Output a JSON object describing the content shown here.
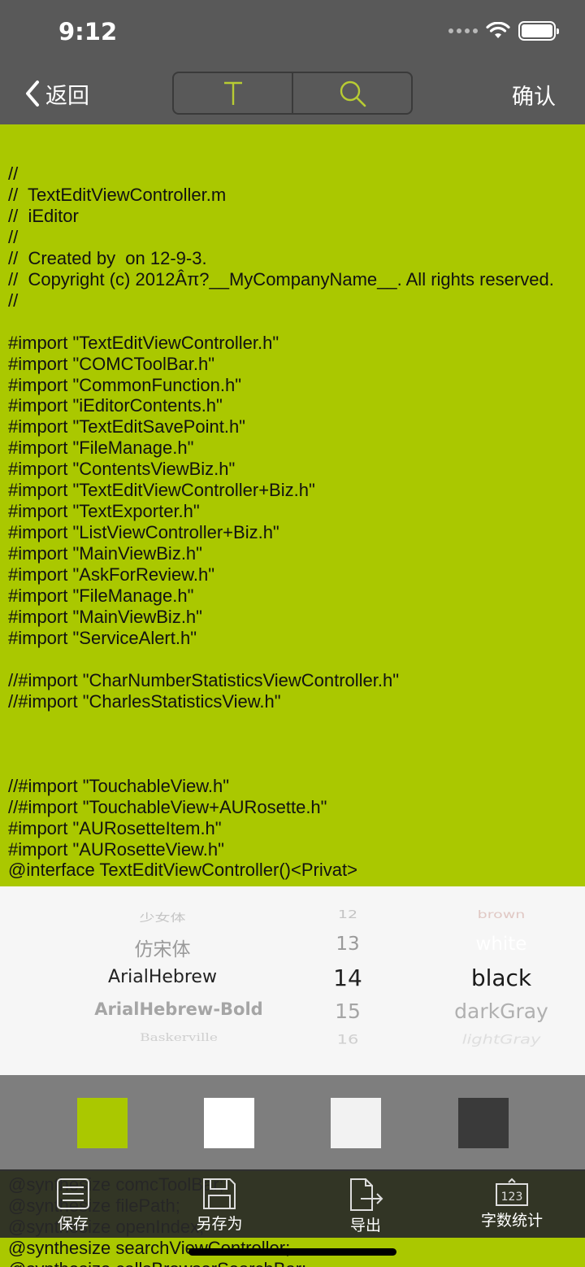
{
  "status_bar": {
    "time": "9:12"
  },
  "nav": {
    "back_label": "返回",
    "confirm_label": "确认",
    "segments": [
      "text-format-icon",
      "search-icon"
    ],
    "accent_color": "#b8cc33"
  },
  "editor_lines": [
    "//",
    "//  TextEditViewController.m",
    "//  iEditor",
    "//",
    "//  Created by  on 12-9-3.",
    "//  Copyright (c) 2012Âπ?__MyCompanyName__. All rights reserved.",
    "//",
    "",
    "#import \"TextEditViewController.h\"",
    "#import \"COMCToolBar.h\"",
    "#import \"CommonFunction.h\"",
    "#import \"iEditorContents.h\"",
    "#import \"TextEditSavePoint.h\"",
    "#import \"FileManage.h\"",
    "#import \"ContentsViewBiz.h\"",
    "#import \"TextEditViewController+Biz.h\"",
    "#import \"TextExporter.h\"",
    "#import \"ListViewController+Biz.h\"",
    "#import \"MainViewBiz.h\"",
    "#import \"AskForReview.h\"",
    "#import \"FileManage.h\"",
    "#import \"MainViewBiz.h\"",
    "#import \"ServiceAlert.h\"",
    "",
    "//#import \"CharNumberStatisticsViewController.h\"",
    "//#import \"CharlesStatisticsView.h\"",
    "",
    "",
    "",
    "//#import \"TouchableView.h\"",
    "//#import \"TouchableView+AURosette.h\"",
    "#import \"AURosetteItem.h\"",
    "#import \"AURosetteView.h\"",
    "@interface TextEditViewController()<Privat>"
  ],
  "editor_bottom_lines": [
    "@synthesize comcToolBar;",
    "@synthesize filePath;",
    "@synthesize openIndex;",
    "@synthesize searchViewController;",
    "@synthesize callsBrowserSearchBar;"
  ],
  "picker": {
    "fonts": [
      "少女体",
      "仿宋体",
      "ArialHebrew",
      "ArialHebrew-Bold",
      "Baskerville"
    ],
    "sizes": [
      "12",
      "13",
      "14",
      "15",
      "16"
    ],
    "colors": [
      "brown",
      "white",
      "black",
      "darkGray",
      "lightGray"
    ],
    "selected_font": "ArialHebrew",
    "selected_size": "14",
    "selected_color": "black"
  },
  "swatches": [
    "#aac800",
    "#ffffff",
    "#f2f2f2",
    "#3a3a3a"
  ],
  "toolbar": {
    "items": [
      {
        "label": "保存",
        "icon": "save-icon"
      },
      {
        "label": "另存为",
        "icon": "save-as-icon"
      },
      {
        "label": "导出",
        "icon": "export-icon"
      },
      {
        "label": "字数统计",
        "icon": "word-count-icon"
      }
    ]
  }
}
